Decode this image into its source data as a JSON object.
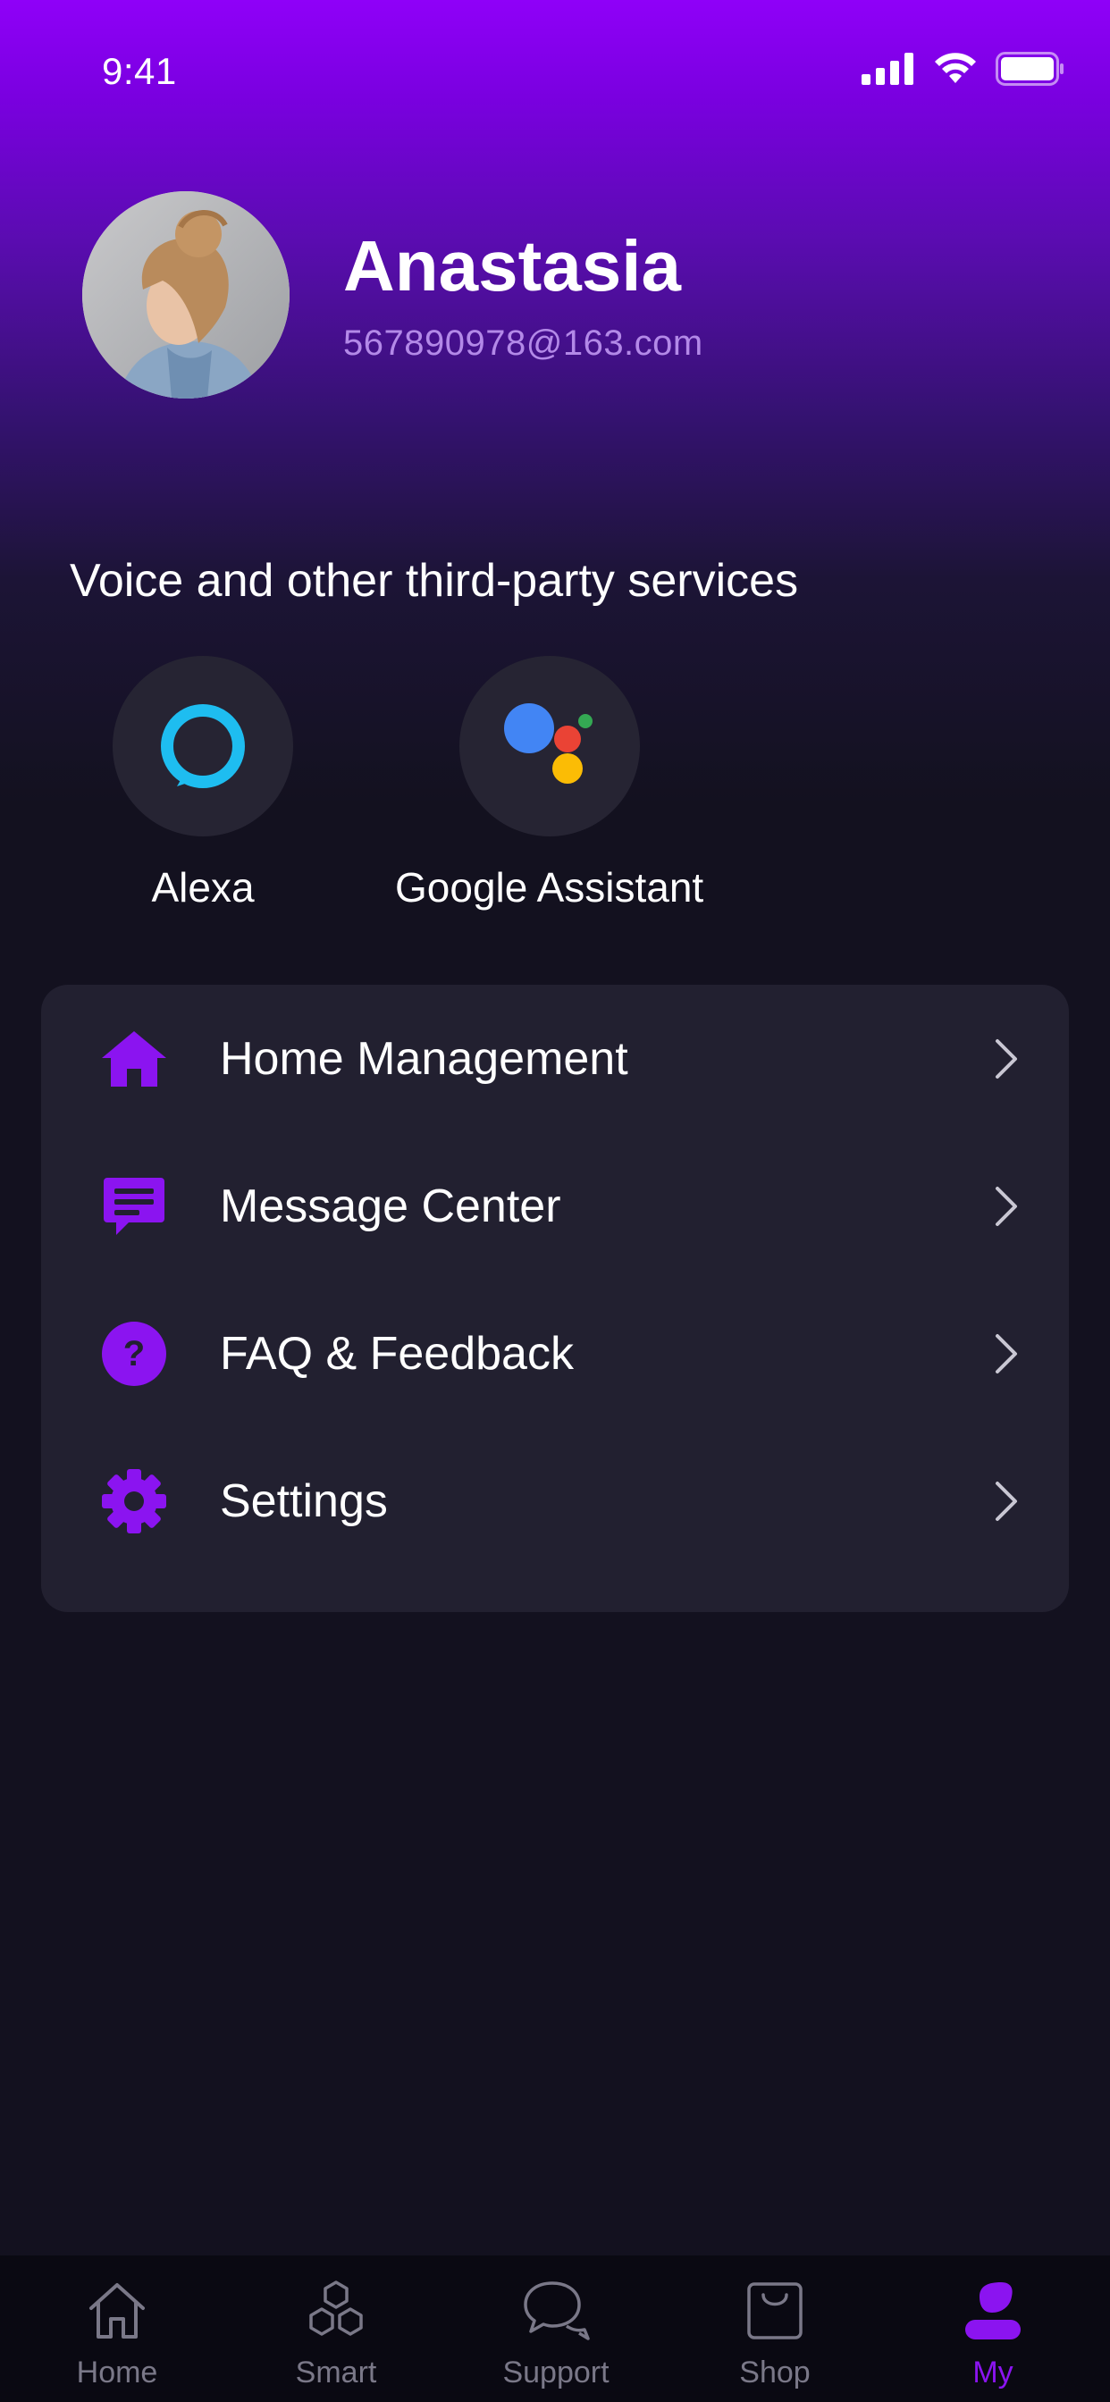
{
  "status_bar": {
    "time": "9:41"
  },
  "profile": {
    "name": "Anastasia",
    "email": "567890978@163.com"
  },
  "voice_services": {
    "title": "Voice and other third-party services",
    "items": [
      {
        "label": "Alexa",
        "icon": "alexa-icon"
      },
      {
        "label": "Google Assistant",
        "icon": "google-assistant-icon"
      }
    ]
  },
  "menu": {
    "items": [
      {
        "label": "Home Management",
        "icon": "house-icon"
      },
      {
        "label": "Message Center",
        "icon": "message-icon"
      },
      {
        "label": "FAQ & Feedback",
        "icon": "question-icon"
      },
      {
        "label": "Settings",
        "icon": "gear-icon"
      }
    ]
  },
  "tab_bar": {
    "items": [
      {
        "label": "Home",
        "icon": "home-outline-icon"
      },
      {
        "label": "Smart",
        "icon": "hexagons-icon"
      },
      {
        "label": "Support",
        "icon": "chat-bubbles-icon"
      },
      {
        "label": "Shop",
        "icon": "shopping-bag-icon"
      },
      {
        "label": "My",
        "icon": "person-icon"
      }
    ],
    "active": "My"
  },
  "colors": {
    "accent": "#8b14f0",
    "background": "#13111f",
    "card": "#222030",
    "email_text": "#b389e8"
  }
}
